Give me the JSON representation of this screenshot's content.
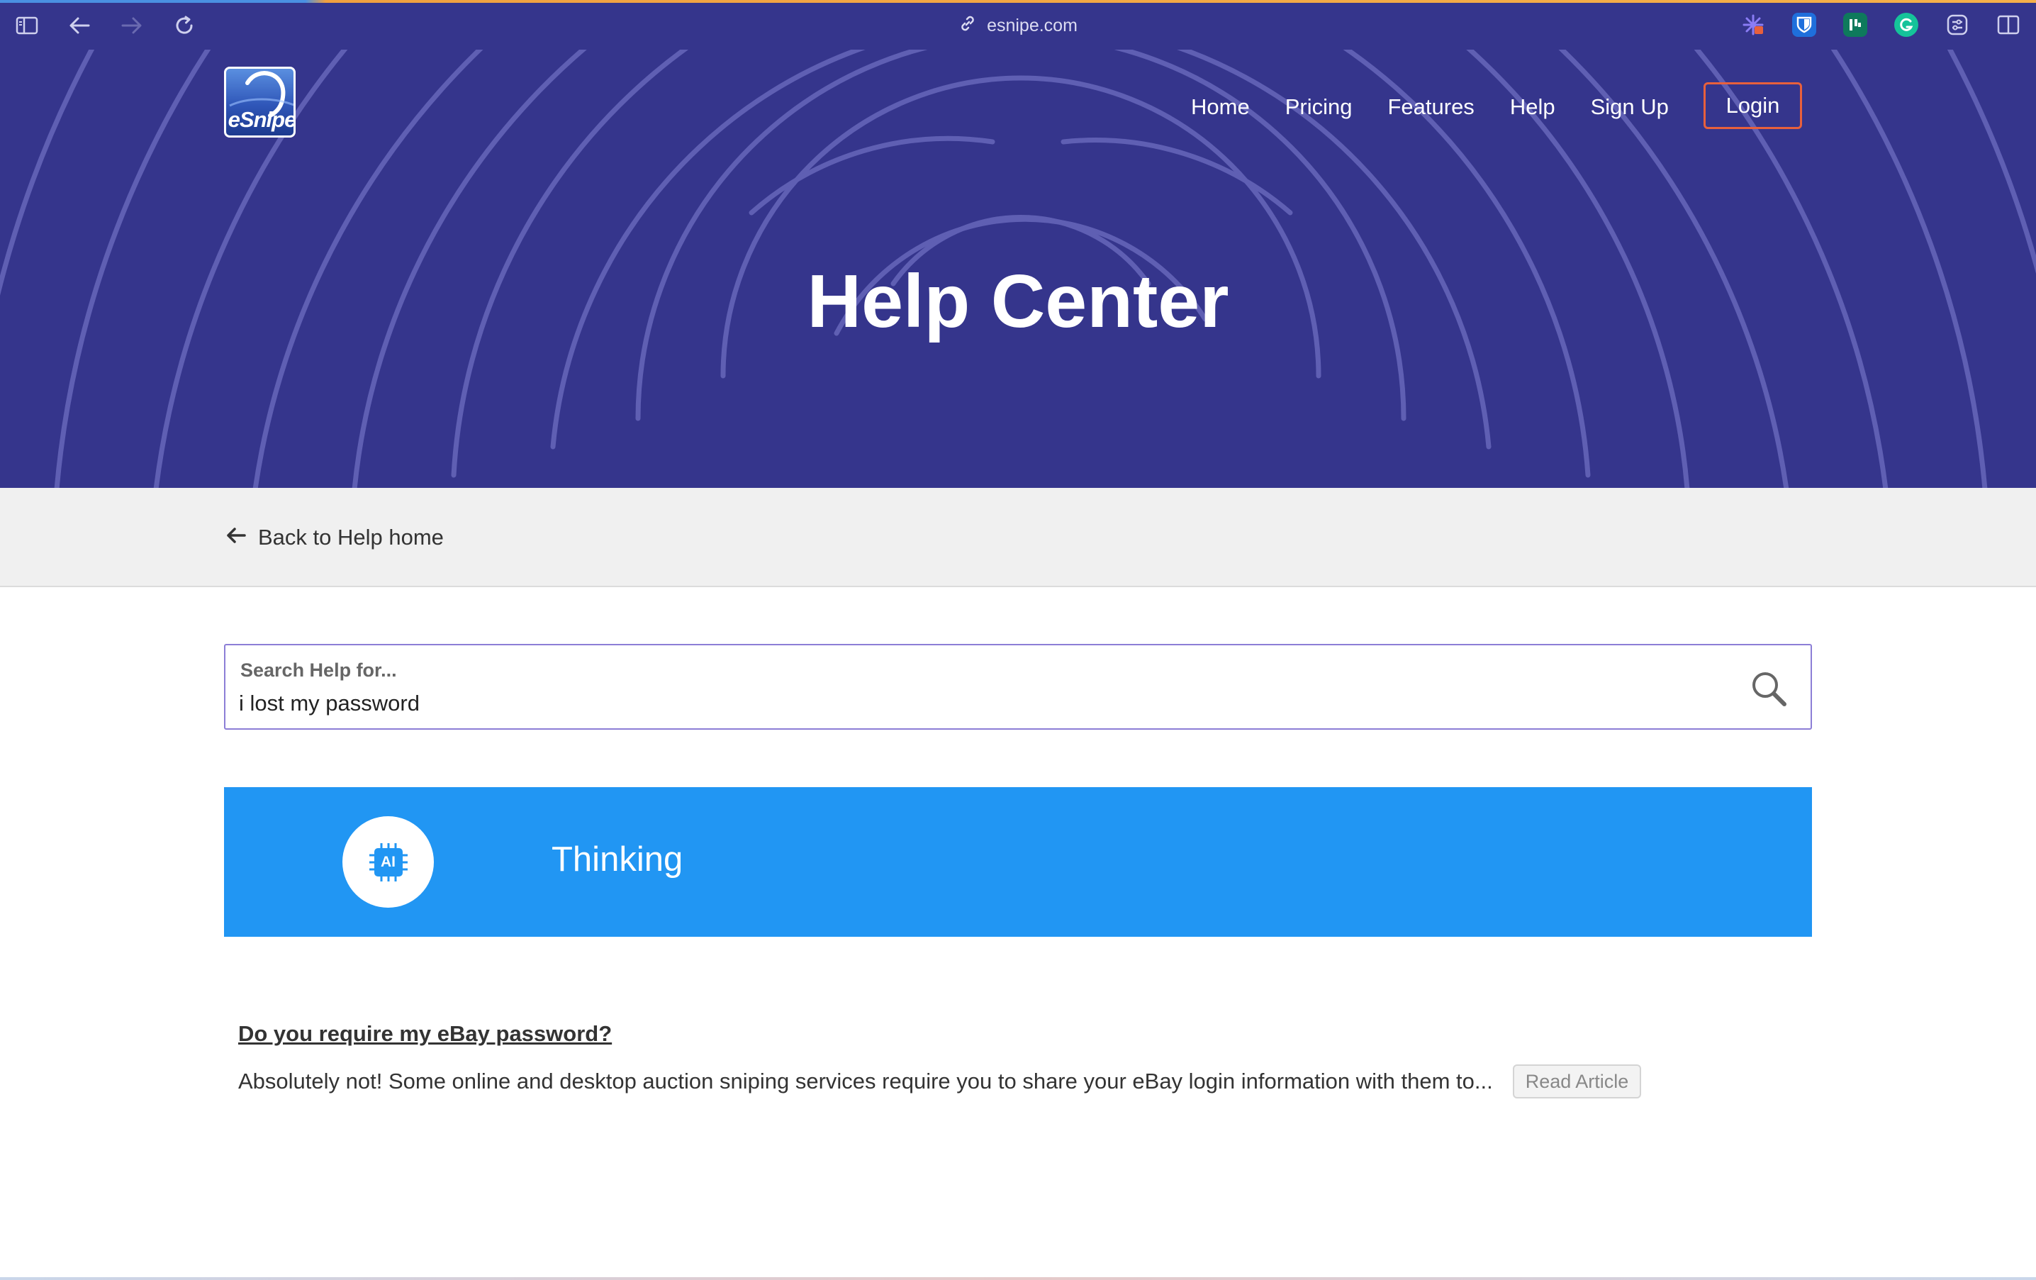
{
  "browser": {
    "url": "esnipe.com",
    "icons": [
      "sidebar-icon",
      "back-arrow-icon",
      "forward-arrow-icon",
      "reload-icon",
      "link-icon"
    ],
    "extensions": [
      "sparkle-extension-icon",
      "bitwarden-shield-icon",
      "extension-dark-green-icon",
      "grammarly-icon",
      "settings-sliders-icon",
      "split-view-icon"
    ]
  },
  "header": {
    "logo_text": "eSnipe",
    "nav": [
      "Home",
      "Pricing",
      "Features",
      "Help",
      "Sign Up"
    ],
    "login_label": "Login",
    "title": "Help Center"
  },
  "backbar": {
    "label": "Back to Help home"
  },
  "search": {
    "label": "Search Help for...",
    "value": "i lost my password"
  },
  "ai": {
    "badge": "AI",
    "status": "Thinking"
  },
  "result": {
    "title": "Do you require my eBay password?",
    "excerpt": "Absolutely not!  Some online and desktop auction sniping services require you to share your eBay login information with them to...",
    "button_label": "Read Article"
  },
  "colors": {
    "hero_bg": "#35358c",
    "accent_blue": "#2196f3",
    "login_border": "#e8603c",
    "search_border": "#8c7ed6"
  }
}
